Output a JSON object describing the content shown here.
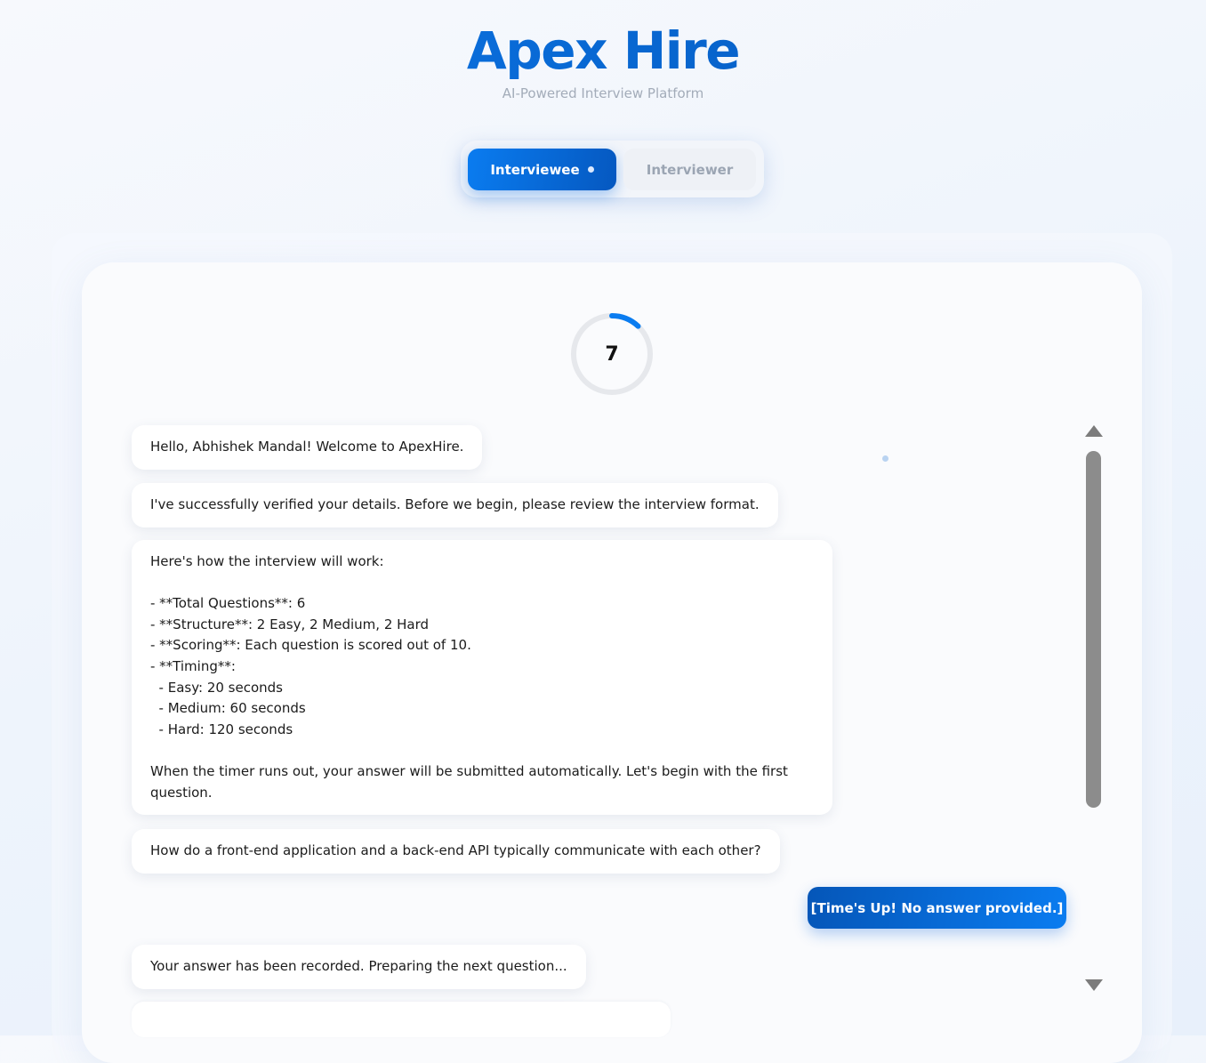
{
  "header": {
    "title": "Apex Hire",
    "tagline": "AI-Powered Interview Platform"
  },
  "tabs": {
    "interviewee": "Interviewee",
    "interviewer": "Interviewer",
    "active": "Interviewee"
  },
  "timer": {
    "value": "7",
    "progress_fraction": 0.12,
    "track_color": "#e6e8ec",
    "arc_color": "#0a7cf0"
  },
  "chat": {
    "messages": [
      {
        "role": "bot",
        "text": "Hello, Abhishek Mandal! Welcome to ApexHire."
      },
      {
        "role": "bot",
        "text": "I've successfully verified your details. Before we begin, please review the interview format."
      },
      {
        "role": "bot",
        "text": "Here's how the interview will work:\n\n- **Total Questions**: 6\n- **Structure**: 2 Easy, 2 Medium, 2 Hard\n- **Scoring**: Each question is scored out of 10.\n- **Timing**:\n  - Easy: 20 seconds\n  - Medium: 60 seconds\n  - Hard: 120 seconds\n\nWhen the timer runs out, your answer will be submitted automatically. Let's begin with the first question."
      },
      {
        "role": "bot",
        "text": "How do a front-end application and a back-end API typically communicate with each other?"
      },
      {
        "role": "user",
        "text": "[Time's Up! No answer provided.]"
      },
      {
        "role": "bot",
        "text": "Your answer has been recorded. Preparing the next question..."
      },
      {
        "role": "bot",
        "text": ""
      }
    ]
  },
  "colors": {
    "brand": "#0a6fd8",
    "accent_gradient_start": "#0a7cf0",
    "accent_gradient_end": "#0558c0"
  }
}
